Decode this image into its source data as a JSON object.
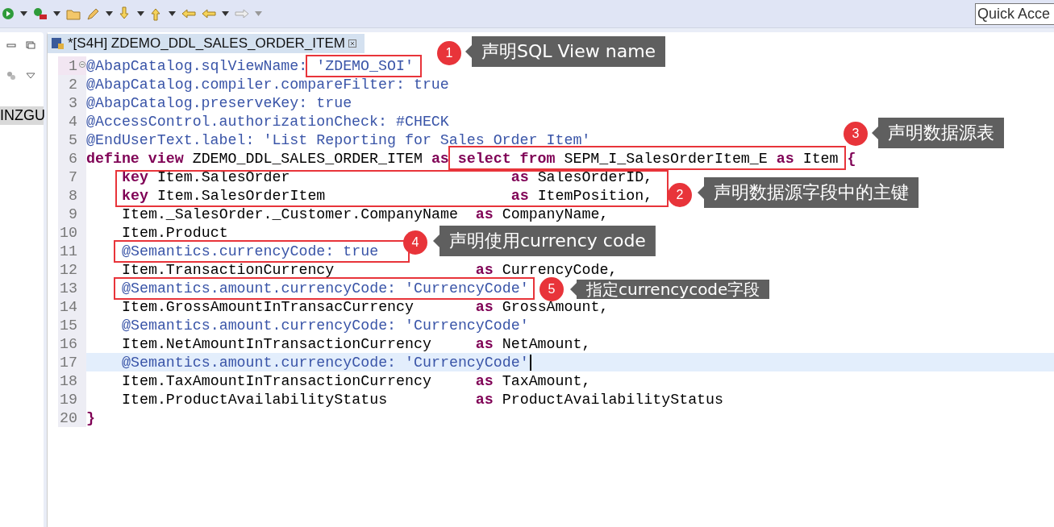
{
  "toolbar": {
    "quick_access": {
      "placeholder": "Quick Acce"
    }
  },
  "left_panel": {
    "items": [
      {
        "label": "INZGU",
        "selected": true
      }
    ]
  },
  "editor": {
    "tab": {
      "title": "*[S4H] ZDEMO_DDL_SALES_ORDER_ITEM",
      "selected": true
    },
    "lines": [
      {
        "number": "1",
        "indented": false,
        "current": false,
        "tokens": [
          {
            "kind": "ann",
            "text": "@AbapCatalog.sqlViewName:"
          },
          {
            "kind": "ann",
            "text": " 'ZDEMO_SOI'"
          }
        ]
      },
      {
        "number": "2",
        "indented": false,
        "current": false,
        "tokens": [
          {
            "kind": "ann",
            "text": "@AbapCatalog.compiler.compareFilter: true"
          }
        ]
      },
      {
        "number": "3",
        "indented": false,
        "current": false,
        "tokens": [
          {
            "kind": "ann",
            "text": "@AbapCatalog.preserveKey: true"
          }
        ]
      },
      {
        "number": "4",
        "indented": false,
        "current": false,
        "tokens": [
          {
            "kind": "ann",
            "text": "@AccessControl.authorizationCheck: #CHECK"
          }
        ]
      },
      {
        "number": "5",
        "indented": false,
        "current": false,
        "tokens": [
          {
            "kind": "ann",
            "text": "@EndUserText.label: 'List Reporting for Sales Order Item'"
          }
        ]
      },
      {
        "number": "6",
        "indented": false,
        "current": false,
        "tokens": [
          {
            "kind": "kw",
            "text": "define"
          },
          {
            "kind": "kw",
            "text": " view"
          },
          {
            "kind": "plain",
            "text": " ZDEMO_DDL_SALES_ORDER_ITEM"
          },
          {
            "kind": "kw",
            "text": " as"
          },
          {
            "kind": "kw",
            "text": " select"
          },
          {
            "kind": "kw",
            "text": " from"
          },
          {
            "kind": "plain",
            "text": " SEPM_I_SalesOrderItem_E"
          },
          {
            "kind": "kw",
            "text": " as"
          },
          {
            "kind": "plain",
            "text": " Item"
          },
          {
            "kind": "kw",
            "text": " {"
          }
        ]
      },
      {
        "number": "7",
        "indented": true,
        "current": false,
        "tokens": [
          {
            "kind": "kw",
            "text": "key"
          },
          {
            "kind": "plain",
            "text": " Item.SalesOrder"
          },
          {
            "kind": "kw",
            "text": "                         as"
          },
          {
            "kind": "plain",
            "text": " SalesOrderID,"
          }
        ]
      },
      {
        "number": "8",
        "indented": true,
        "current": false,
        "tokens": [
          {
            "kind": "kw",
            "text": "key"
          },
          {
            "kind": "plain",
            "text": " Item.SalesOrderItem"
          },
          {
            "kind": "kw",
            "text": "                     as"
          },
          {
            "kind": "plain",
            "text": " ItemPosition,"
          }
        ]
      },
      {
        "number": "9",
        "indented": true,
        "current": false,
        "tokens": [
          {
            "kind": "plain",
            "text": "Item._SalesOrder._Customer.CompanyName"
          },
          {
            "kind": "kw",
            "text": "  as"
          },
          {
            "kind": "plain",
            "text": " CompanyName,"
          }
        ]
      },
      {
        "number": "10",
        "indented": true,
        "current": false,
        "tokens": [
          {
            "kind": "plain",
            "text": "Item.Product"
          }
        ]
      },
      {
        "number": "11",
        "indented": true,
        "current": false,
        "tokens": [
          {
            "kind": "ann",
            "text": "@Semantics.currencyCode: true"
          }
        ]
      },
      {
        "number": "12",
        "indented": true,
        "current": false,
        "tokens": [
          {
            "kind": "plain",
            "text": "Item.TransactionCurrency"
          },
          {
            "kind": "kw",
            "text": "                as"
          },
          {
            "kind": "plain",
            "text": " CurrencyCode,"
          }
        ]
      },
      {
        "number": "13",
        "indented": true,
        "current": false,
        "tokens": [
          {
            "kind": "ann",
            "text": "@Semantics.amount.currencyCode: 'CurrencyCode'"
          }
        ]
      },
      {
        "number": "14",
        "indented": true,
        "current": false,
        "tokens": [
          {
            "kind": "plain",
            "text": "Item.GrossAmountInTransacCurrency"
          },
          {
            "kind": "kw",
            "text": "       as"
          },
          {
            "kind": "plain",
            "text": " GrossAmount,"
          }
        ]
      },
      {
        "number": "15",
        "indented": true,
        "current": false,
        "tokens": [
          {
            "kind": "ann",
            "text": "@Semantics.amount.currencyCode: 'CurrencyCode'"
          }
        ]
      },
      {
        "number": "16",
        "indented": true,
        "current": false,
        "tokens": [
          {
            "kind": "plain",
            "text": "Item.NetAmountInTransactionCurrency"
          },
          {
            "kind": "kw",
            "text": "     as"
          },
          {
            "kind": "plain",
            "text": " NetAmount,"
          }
        ]
      },
      {
        "number": "17",
        "indented": true,
        "current": true,
        "tokens": [
          {
            "kind": "ann",
            "text": "@Semantics.amount.currencyCode: 'CurrencyCode'"
          }
        ]
      },
      {
        "number": "18",
        "indented": true,
        "current": false,
        "tokens": [
          {
            "kind": "plain",
            "text": "Item.TaxAmountInTransactionCurrency"
          },
          {
            "kind": "kw",
            "text": "     as"
          },
          {
            "kind": "plain",
            "text": " TaxAmount,"
          }
        ]
      },
      {
        "number": "19",
        "indented": true,
        "current": false,
        "tokens": [
          {
            "kind": "plain",
            "text": "Item.ProductAvailabilityStatus"
          },
          {
            "kind": "kw",
            "text": "          as"
          },
          {
            "kind": "plain",
            "text": " ProductAvailabilityStatus"
          }
        ]
      },
      {
        "number": "20",
        "indented": false,
        "current": false,
        "tokens": [
          {
            "kind": "kw",
            "text": "}"
          }
        ]
      }
    ]
  },
  "callouts": [
    {
      "number": "1",
      "text": "声明SQL View name"
    },
    {
      "number": "2",
      "text": "声明数据源字段中的主键"
    },
    {
      "number": "3",
      "text": "声明数据源表"
    },
    {
      "number": "4",
      "text": "声明使用currency code"
    },
    {
      "number": "5",
      "text": "指定currencycode字段"
    }
  ]
}
